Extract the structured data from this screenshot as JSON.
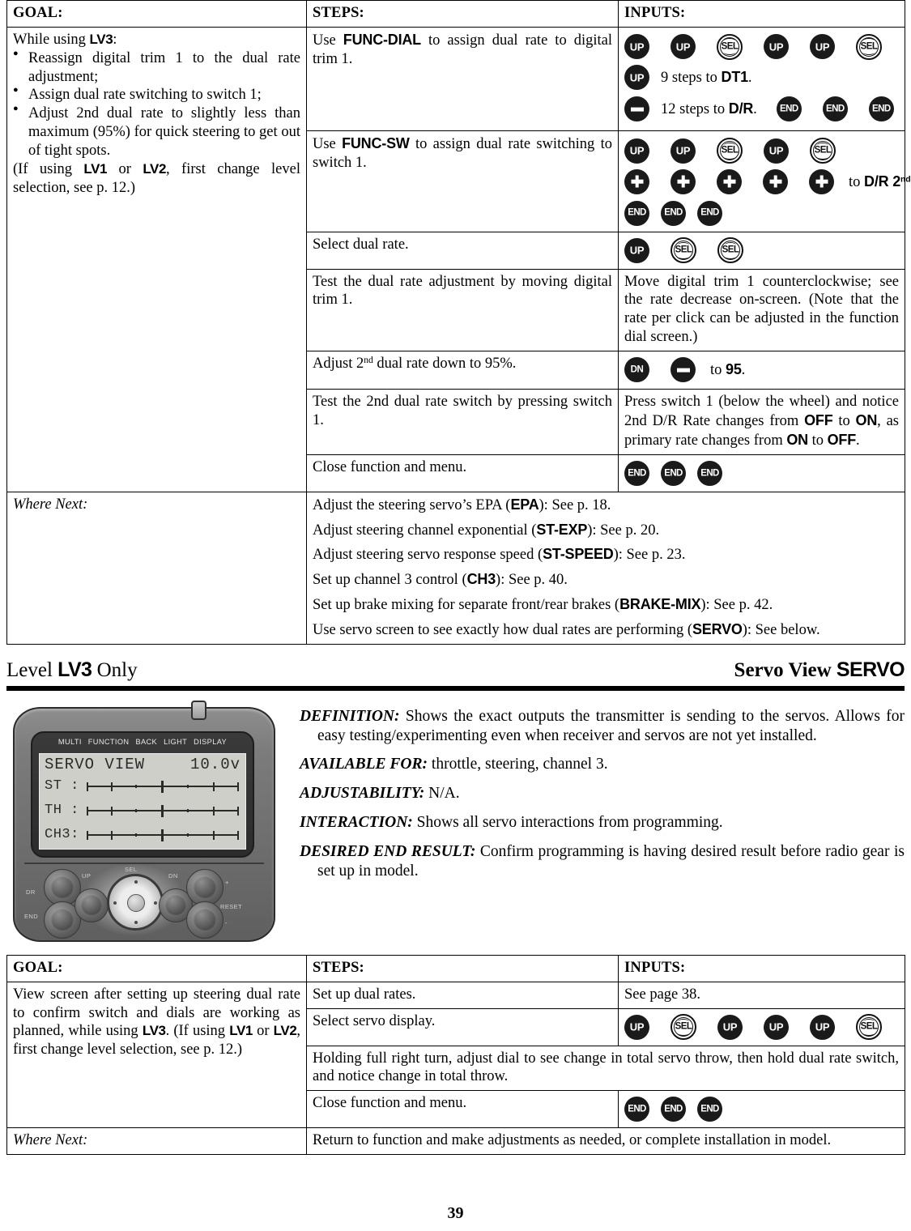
{
  "table_top": {
    "headers": {
      "goal": "GOAL:",
      "steps": "STEPS:",
      "inputs": "INPUTS:"
    },
    "goal": {
      "intro_prefix": "While using ",
      "intro_code": "LV3",
      "intro_suffix": ":",
      "bullets": [
        "Reassign digital trim 1 to the dual rate adjustment;",
        "Assign dual rate switching to switch 1;",
        "Adjust 2nd dual rate to slightly less than maximum (95%) for quick steering to get out of tight spots."
      ],
      "note_a": "(If using ",
      "note_lv1": "LV1",
      "note_or": " or ",
      "note_lv2": "LV2",
      "note_b": ", first change level selection, see p. 12.)"
    },
    "rows": [
      {
        "step_a": "Use ",
        "step_code": "FUNC-DIAL",
        "step_b": " to assign dual rate to digital trim 1.",
        "keys_line1": [
          "UP",
          "UP",
          "SEL",
          "UP",
          "UP",
          "SEL"
        ],
        "line2_key": "UP",
        "line2_text_a": "9 steps to ",
        "line2_code": "DT1",
        "line2_text_b": ".",
        "line3_key": "minus",
        "line3_text_a": "12 steps to ",
        "line3_code": "D/R",
        "line3_text_b": ".",
        "line3_keys": [
          "END",
          "END",
          "END"
        ]
      },
      {
        "step_a": "Use ",
        "step_code": "FUNC-SW",
        "step_b": " to assign dual rate switching to switch 1.",
        "keys_line1": [
          "UP",
          "UP",
          "SEL",
          "UP",
          "SEL"
        ],
        "plus_count": 5,
        "plus_text_a": "to ",
        "plus_code": "D/R 2",
        "plus_sup": "nd",
        "plus_text_b": ".",
        "keys_line3": [
          "END",
          "END",
          "END"
        ]
      },
      {
        "step": "Select dual rate.",
        "keys": [
          "UP",
          "SEL",
          "SEL"
        ]
      },
      {
        "step": "Test the dual rate adjustment by moving digital trim 1.",
        "input_text": "Move digital trim 1 counterclockwise; see the rate decrease on-screen. (Note that the rate per click can be adjusted in the function dial screen.)"
      },
      {
        "step_a": "Adjust 2",
        "step_sup": "nd",
        "step_b": " dual rate down to 95%.",
        "keys": [
          "DN",
          "minus"
        ],
        "tail_a": "to ",
        "tail_code": "95",
        "tail_b": "."
      },
      {
        "step": "Test the 2nd dual rate switch by pressing switch 1.",
        "input_a": "Press switch 1 (below the wheel) and notice 2nd D/R Rate changes from ",
        "input_off1": "OFF",
        "input_b": " to ",
        "input_on1": "ON",
        "input_c": ", as primary rate changes from ",
        "input_on2": "ON",
        "input_d": " to ",
        "input_off2": "OFF",
        "input_e": "."
      },
      {
        "step": "Close function and menu.",
        "keys": [
          "END",
          "END",
          "END"
        ]
      }
    ],
    "where_next_label": "Where Next:",
    "where_next": [
      {
        "a": "Adjust the steering servo’s EPA (",
        "code": "EPA",
        "b": "): See p. 18."
      },
      {
        "a": "Adjust steering channel exponential (",
        "code": "ST-EXP",
        "b": "): See p. 20."
      },
      {
        "a": "Adjust steering servo response speed (",
        "code": "ST-SPEED",
        "b": "): See p. 23."
      },
      {
        "a": "Set up channel 3 control (",
        "code": "CH3",
        "b": "): See p. 40."
      },
      {
        "a": "Set up brake mixing for separate front/rear brakes (",
        "code": "BRAKE-MIX",
        "b": "): See p. 42."
      },
      {
        "a": "Use servo screen to see exactly how dual rates are performing (",
        "code": "SERVO",
        "b": "): See below."
      }
    ]
  },
  "band": {
    "left_a": "Level ",
    "left_code": "LV3",
    "left_b": " Only",
    "right_a": "Servo View ",
    "right_code": "SERVO"
  },
  "transmitter": {
    "menu_items": [
      "MULTI",
      "FUNCTION",
      "BACK",
      "LIGHT",
      "DISPLAY"
    ],
    "screen_title": "SERVO VIEW",
    "screen_voltage": "10.0v",
    "channels": [
      {
        "label": "ST :"
      },
      {
        "label": "TH :"
      },
      {
        "label": "CH3:"
      }
    ],
    "face_labels": [
      "DR",
      "END",
      "UP",
      "SEL",
      "DN",
      "+",
      "RESET",
      "-"
    ]
  },
  "description": [
    {
      "term": "DEFINITION:",
      "text": " Shows the exact outputs the transmitter is sending to the servos. Allows for easy testing/experimenting even when receiver and servos are not yet installed."
    },
    {
      "term": "AVAILABLE FOR:",
      "text": " throttle, steering, channel 3."
    },
    {
      "term": "ADJUSTABILITY:",
      "text": " N/A."
    },
    {
      "term": "INTERACTION:",
      "text": " Shows all servo interactions from programming."
    },
    {
      "term": "DESIRED END RESULT:",
      "text": " Confirm programming is having desired result before radio gear is set up in model."
    }
  ],
  "table_bottom": {
    "headers": {
      "goal": "GOAL:",
      "steps": "STEPS:",
      "inputs": "INPUTS:"
    },
    "goal": {
      "a": "View screen after setting up steering dual rate to confirm switch and dials are working as planned, while using ",
      "lv3": "LV3",
      "b": ". (If using ",
      "lv1": "LV1",
      "or": " or ",
      "lv2": "LV2",
      "c": ", first change level selection, see p. 12.)"
    },
    "rows": [
      {
        "step": "Set up dual rates.",
        "input_text": "See page 38."
      },
      {
        "step": "Select servo display.",
        "keys": [
          "UP",
          "SEL",
          "UP",
          "UP",
          "UP",
          "SEL"
        ]
      },
      {
        "span_text": "Holding full right turn, adjust dial to see change in total servo throw, then hold dual rate switch, and notice change in total throw."
      },
      {
        "step": "Close function and menu.",
        "keys": [
          "END",
          "END",
          "END"
        ]
      }
    ],
    "where_next_label": "Where Next:",
    "where_next_text": "Return to function and make adjustments as needed, or complete installation in model."
  },
  "footer": {
    "page_number": "39"
  }
}
